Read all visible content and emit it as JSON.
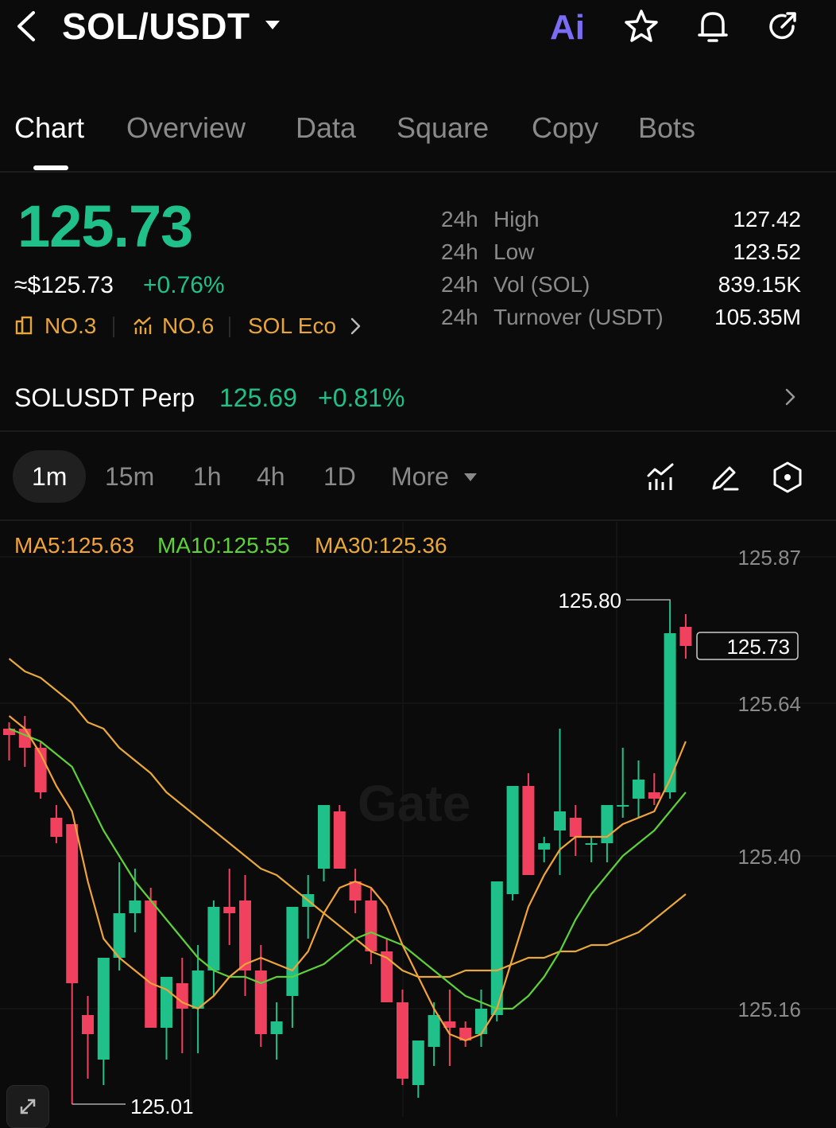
{
  "header": {
    "title": "SOL/USDT",
    "ai_label": "Ai",
    "icons": [
      "back-chevron-icon",
      "dropdown-caret-icon",
      "star-icon",
      "bell-icon",
      "share-icon"
    ]
  },
  "tabs": [
    {
      "label": "Chart",
      "active": true
    },
    {
      "label": "Overview"
    },
    {
      "label": "Data"
    },
    {
      "label": "Square"
    },
    {
      "label": "Copy"
    },
    {
      "label": "Bots"
    }
  ],
  "price": {
    "last": "125.73",
    "usd": "≈$125.73",
    "change": "+0.76%",
    "rank1": "NO.3",
    "rank2": "NO.6",
    "eco": "SOL Eco"
  },
  "stats": [
    {
      "period": "24h",
      "name": "High",
      "value": "127.42"
    },
    {
      "period": "24h",
      "name": "Low",
      "value": "123.52"
    },
    {
      "period": "24h",
      "name": "Vol (SOL)",
      "value": "839.15K"
    },
    {
      "period": "24h",
      "name": "Turnover (USDT)",
      "value": "105.35M"
    }
  ],
  "perp": {
    "name": "SOLUSDT Perp",
    "price": "125.69",
    "change": "+0.81%"
  },
  "intervals": [
    "1m",
    "15m",
    "1h",
    "4h",
    "1D",
    "More"
  ],
  "active_interval": "1m",
  "ma": {
    "ma5": "MA5:125.63",
    "ma10": "MA10:125.55",
    "ma30": "MA30:125.36"
  },
  "colors": {
    "up": "#20c08a",
    "down": "#f0415e",
    "ma5": "#f0a33a",
    "ma10": "#5dd13a",
    "ma30": "#e8a93a",
    "accent_orange": "#e7a53c",
    "ai": "#7b6cf6"
  },
  "chart_data": {
    "type": "candlestick",
    "y_ticks": [
      "125.87",
      "125.64",
      "125.40",
      "125.16"
    ],
    "ylim": [
      125.01,
      125.88
    ],
    "annotations": {
      "high_label": "125.80",
      "low_label": "125.01",
      "last_price_tag": "125.73"
    },
    "watermark": "Gate",
    "candles": [
      {
        "o": 125.6,
        "h": 125.61,
        "l": 125.55,
        "c": 125.59
      },
      {
        "o": 125.6,
        "h": 125.62,
        "l": 125.54,
        "c": 125.57
      },
      {
        "o": 125.57,
        "h": 125.58,
        "l": 125.49,
        "c": 125.5
      },
      {
        "o": 125.46,
        "h": 125.48,
        "l": 125.42,
        "c": 125.43
      },
      {
        "o": 125.45,
        "h": 125.45,
        "l": 125.01,
        "c": 125.2
      },
      {
        "o": 125.15,
        "h": 125.18,
        "l": 125.05,
        "c": 125.12
      },
      {
        "o": 125.08,
        "h": 125.24,
        "l": 125.04,
        "c": 125.24
      },
      {
        "o": 125.24,
        "h": 125.39,
        "l": 125.22,
        "c": 125.31
      },
      {
        "o": 125.31,
        "h": 125.38,
        "l": 125.28,
        "c": 125.33
      },
      {
        "o": 125.33,
        "h": 125.35,
        "l": 125.13,
        "c": 125.13
      },
      {
        "o": 125.13,
        "h": 125.2,
        "l": 125.08,
        "c": 125.21
      },
      {
        "o": 125.2,
        "h": 125.24,
        "l": 125.09,
        "c": 125.16
      },
      {
        "o": 125.16,
        "h": 125.26,
        "l": 125.09,
        "c": 125.22
      },
      {
        "o": 125.22,
        "h": 125.33,
        "l": 125.18,
        "c": 125.32
      },
      {
        "o": 125.32,
        "h": 125.38,
        "l": 125.26,
        "c": 125.31
      },
      {
        "o": 125.33,
        "h": 125.37,
        "l": 125.18,
        "c": 125.22
      },
      {
        "o": 125.22,
        "h": 125.26,
        "l": 125.1,
        "c": 125.12
      },
      {
        "o": 125.12,
        "h": 125.17,
        "l": 125.08,
        "c": 125.14
      },
      {
        "o": 125.18,
        "h": 125.32,
        "l": 125.13,
        "c": 125.32
      },
      {
        "o": 125.32,
        "h": 125.37,
        "l": 125.27,
        "c": 125.34
      },
      {
        "o": 125.38,
        "h": 125.48,
        "l": 125.36,
        "c": 125.48
      },
      {
        "o": 125.47,
        "h": 125.48,
        "l": 125.38,
        "c": 125.38
      },
      {
        "o": 125.36,
        "h": 125.38,
        "l": 125.31,
        "c": 125.33
      },
      {
        "o": 125.33,
        "h": 125.35,
        "l": 125.23,
        "c": 125.25
      },
      {
        "o": 125.25,
        "h": 125.27,
        "l": 125.17,
        "c": 125.17
      },
      {
        "o": 125.17,
        "h": 125.19,
        "l": 125.04,
        "c": 125.05
      },
      {
        "o": 125.04,
        "h": 125.11,
        "l": 125.02,
        "c": 125.11
      },
      {
        "o": 125.1,
        "h": 125.17,
        "l": 125.07,
        "c": 125.15
      },
      {
        "o": 125.14,
        "h": 125.19,
        "l": 125.07,
        "c": 125.13
      },
      {
        "o": 125.13,
        "h": 125.14,
        "l": 125.1,
        "c": 125.11
      },
      {
        "o": 125.12,
        "h": 125.19,
        "l": 125.1,
        "c": 125.16
      },
      {
        "o": 125.15,
        "h": 125.36,
        "l": 125.14,
        "c": 125.36
      },
      {
        "o": 125.34,
        "h": 125.51,
        "l": 125.33,
        "c": 125.51
      },
      {
        "o": 125.51,
        "h": 125.53,
        "l": 125.37,
        "c": 125.37
      },
      {
        "o": 125.41,
        "h": 125.43,
        "l": 125.39,
        "c": 125.42
      },
      {
        "o": 125.44,
        "h": 125.6,
        "l": 125.37,
        "c": 125.47
      },
      {
        "o": 125.46,
        "h": 125.48,
        "l": 125.4,
        "c": 125.43
      },
      {
        "o": 125.42,
        "h": 125.43,
        "l": 125.39,
        "c": 125.42
      },
      {
        "o": 125.42,
        "h": 125.48,
        "l": 125.39,
        "c": 125.48
      },
      {
        "o": 125.48,
        "h": 125.57,
        "l": 125.46,
        "c": 125.48
      },
      {
        "o": 125.49,
        "h": 125.55,
        "l": 125.46,
        "c": 125.52
      },
      {
        "o": 125.5,
        "h": 125.53,
        "l": 125.48,
        "c": 125.49
      },
      {
        "o": 125.5,
        "h": 125.8,
        "l": 125.49,
        "c": 125.75
      },
      {
        "o": 125.76,
        "h": 125.78,
        "l": 125.71,
        "c": 125.73
      }
    ],
    "ma5": [
      125.62,
      125.6,
      125.56,
      125.51,
      125.47,
      125.36,
      125.27,
      125.24,
      125.22,
      125.2,
      125.19,
      125.17,
      125.16,
      125.18,
      125.21,
      125.23,
      125.24,
      125.23,
      125.22,
      125.25,
      125.31,
      125.35,
      125.36,
      125.35,
      125.32,
      125.26,
      125.21,
      125.16,
      125.12,
      125.11,
      125.12,
      125.16,
      125.24,
      125.32,
      125.37,
      125.41,
      125.43,
      125.43,
      125.43,
      125.45,
      125.46,
      125.47,
      125.52,
      125.58
    ],
    "ma10": [
      125.6,
      125.59,
      125.58,
      125.56,
      125.54,
      125.49,
      125.44,
      125.4,
      125.36,
      125.33,
      125.3,
      125.27,
      125.24,
      125.22,
      125.21,
      125.21,
      125.2,
      125.21,
      125.21,
      125.22,
      125.23,
      125.25,
      125.27,
      125.28,
      125.27,
      125.26,
      125.24,
      125.22,
      125.2,
      125.18,
      125.17,
      125.16,
      125.16,
      125.18,
      125.21,
      125.25,
      125.3,
      125.34,
      125.37,
      125.4,
      125.42,
      125.44,
      125.47,
      125.5
    ],
    "ma30": [
      125.71,
      125.69,
      125.68,
      125.66,
      125.64,
      125.61,
      125.6,
      125.57,
      125.55,
      125.53,
      125.5,
      125.48,
      125.46,
      125.44,
      125.42,
      125.4,
      125.38,
      125.37,
      125.35,
      125.33,
      125.31,
      125.29,
      125.27,
      125.25,
      125.24,
      125.22,
      125.21,
      125.21,
      125.21,
      125.22,
      125.22,
      125.22,
      125.23,
      125.24,
      125.24,
      125.25,
      125.25,
      125.26,
      125.26,
      125.27,
      125.28,
      125.3,
      125.32,
      125.34
    ]
  }
}
